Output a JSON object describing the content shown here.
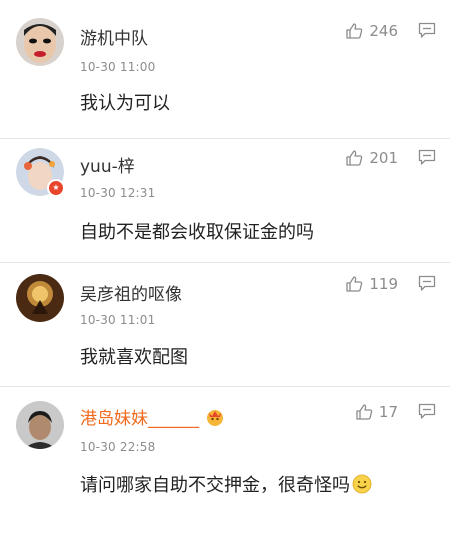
{
  "comments": [
    {
      "username": "游机中队",
      "time": "10-30 11:00",
      "text": "我认为可以",
      "likes": "246"
    },
    {
      "username": "yuu-梓",
      "time": "10-30 12:31",
      "text": "自助不是都会收取保证金的吗",
      "likes": "201"
    },
    {
      "username": "吴彦祖的呕像",
      "time": "10-30 11:01",
      "text": "我就喜欢配图",
      "likes": "119"
    },
    {
      "username": "港岛妹妹______",
      "time": "10-30 22:58",
      "text": "请问哪家自助不交押金，很奇怪吗",
      "likes": "17"
    }
  ],
  "colors": {
    "vip_name": "#f06b1f",
    "meta_gray": "#8c8c8c",
    "divider": "#e4e4e4"
  },
  "icons": {
    "like": "thumbs-up-icon",
    "reply": "comment-icon",
    "emoji": "smile-emoji-icon",
    "vip": "vip-crown-emoji-icon"
  }
}
